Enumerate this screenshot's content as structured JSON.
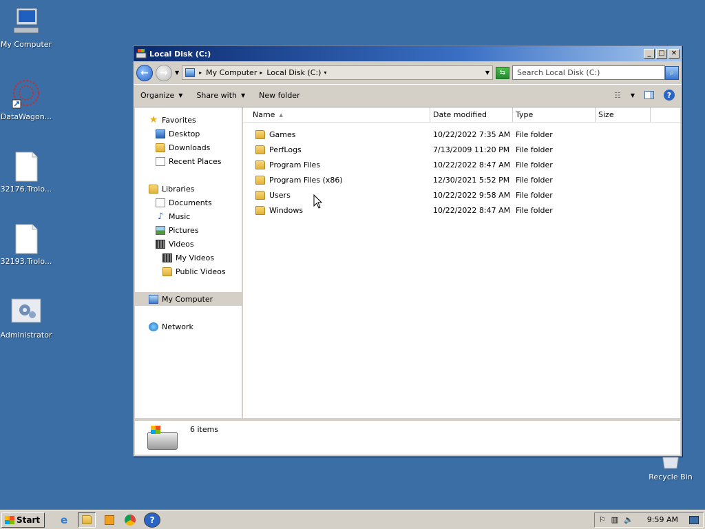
{
  "desktop": {
    "icons": [
      {
        "label": "My Computer",
        "icon": "my-computer-icon"
      },
      {
        "label": "DataWagon...",
        "icon": "datawagon-icon"
      },
      {
        "label": "32176.Trolo...",
        "icon": "document-icon"
      },
      {
        "label": "32193.Trolo...",
        "icon": "document-icon"
      },
      {
        "label": "Administrator",
        "icon": "user-folder-icon"
      },
      {
        "label": "Recycle Bin",
        "icon": "recycle-bin-icon"
      }
    ]
  },
  "window": {
    "title": "Local Disk (C:)",
    "address": {
      "crumbs": [
        "My Computer",
        "Local Disk (C:)"
      ]
    },
    "search": {
      "placeholder": "Search Local Disk (C:)"
    },
    "toolbar": {
      "organize": "Organize",
      "share": "Share with",
      "new_folder": "New folder"
    },
    "nav": {
      "favorites": {
        "label": "Favorites",
        "items": [
          "Desktop",
          "Downloads",
          "Recent Places"
        ]
      },
      "libraries": {
        "label": "Libraries",
        "items": [
          "Documents",
          "Music",
          "Pictures",
          "Videos"
        ],
        "video_sub": [
          "My Videos",
          "Public Videos"
        ]
      },
      "computer": "My Computer",
      "network": "Network"
    },
    "columns": {
      "name": "Name",
      "date": "Date modified",
      "type": "Type",
      "size": "Size"
    },
    "files": [
      {
        "name": "Games",
        "date": "10/22/2022 7:35 AM",
        "type": "File folder"
      },
      {
        "name": "PerfLogs",
        "date": "7/13/2009 11:20 PM",
        "type": "File folder"
      },
      {
        "name": "Program Files",
        "date": "10/22/2022 8:47 AM",
        "type": "File folder"
      },
      {
        "name": "Program Files (x86)",
        "date": "12/30/2021 5:52 PM",
        "type": "File folder"
      },
      {
        "name": "Users",
        "date": "10/22/2022 9:58 AM",
        "type": "File folder"
      },
      {
        "name": "Windows",
        "date": "10/22/2022 8:47 AM",
        "type": "File folder"
      }
    ],
    "status": "6 items"
  },
  "taskbar": {
    "start": "Start",
    "clock": "9:59 AM"
  },
  "colors": {
    "desktop": "#3a6ea5",
    "titlebar": "#0b2a6e"
  }
}
